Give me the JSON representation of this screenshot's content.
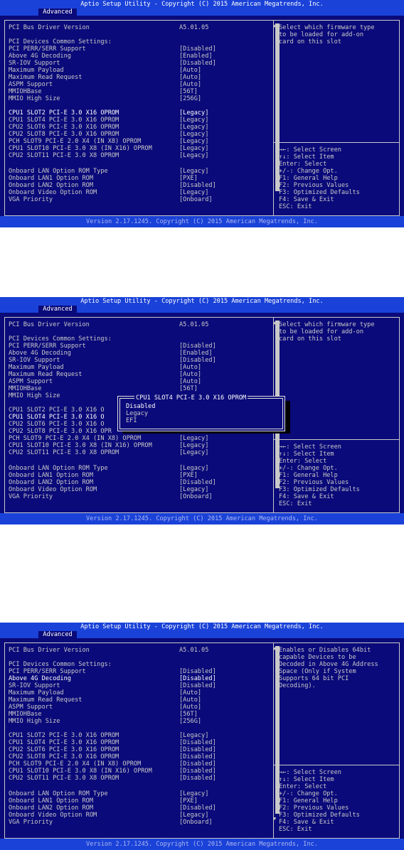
{
  "header_title": "Aptio Setup Utility - Copyright (C) 2015 American Megatrends, Inc.",
  "tab_label": "Advanced",
  "footer_text": "Version 2.17.1245. Copyright (C) 2015 American Megatrends, Inc.",
  "colors": {
    "background": "#0a0a7a",
    "header": "#1a42d8",
    "text": "#c9c9c9",
    "highlight": "#ffffff"
  },
  "screens": [
    {
      "rows": [
        {
          "label": "PCI Bus Driver Version",
          "value": "A5.01.05"
        },
        {
          "label": "PCI Devices Common Settings:",
          "value": ""
        },
        {
          "label": "PCI PERR/SERR Support",
          "value": "[Disabled]"
        },
        {
          "label": "Above 4G Decoding",
          "value": "[Enabled]"
        },
        {
          "label": "SR-IOV Support",
          "value": "[Disabled]"
        },
        {
          "label": "Maximum Payload",
          "value": "[Auto]"
        },
        {
          "label": "Maximum Read Request",
          "value": "[Auto]"
        },
        {
          "label": "ASPM Support",
          "value": "[Auto]"
        },
        {
          "label": "MMIOHBase",
          "value": "[56T]"
        },
        {
          "label": "MMIO High Size",
          "value": "[256G]"
        },
        {
          "label": "CPU1 SLOT2 PCI-E 3.0 X16 OPROM",
          "value": "[Legacy]"
        },
        {
          "label": "CPU1 SLOT4 PCI-E 3.0 X16 OPROM",
          "value": "[Legacy]"
        },
        {
          "label": "CPU2 SLOT6 PCI-E 3.0 X16 OPROM",
          "value": "[Legacy]"
        },
        {
          "label": "CPU2 SLOT8 PCI-E 3.0 X16 OPROM",
          "value": "[Legacy]"
        },
        {
          "label": "PCH SLOT9 PCI-E 2.0 X4 (IN X8) OPROM",
          "value": "[Legacy]"
        },
        {
          "label": "CPU1 SLOT10 PCI-E 3.0 X8 (IN X16) OPROM",
          "value": "[Legacy]"
        },
        {
          "label": "CPU2 SLOT11 PCI-E 3.0 X8 OPROM",
          "value": "[Legacy]"
        },
        {
          "label": "Onboard LAN Option ROM Type",
          "value": "[Legacy]"
        },
        {
          "label": "Onboard LAN1 Option ROM",
          "value": "[PXE]"
        },
        {
          "label": "Onboard LAN2 Option ROM",
          "value": "[Disabled]"
        },
        {
          "label": "Onboard Video Option ROM",
          "value": "[Legacy]"
        },
        {
          "label": "VGA Priority",
          "value": "[Onboard]"
        }
      ],
      "help_lines": [
        "Select which firmware type",
        "to be loaded for add-on",
        "card on this slot"
      ]
    },
    {
      "rows": [
        {
          "label": "PCI Bus Driver Version",
          "value": "A5.01.05"
        },
        {
          "label": "PCI Devices Common Settings:",
          "value": ""
        },
        {
          "label": "PCI PERR/SERR Support",
          "value": "[Disabled]"
        },
        {
          "label": "Above 4G Decoding",
          "value": "[Enabled]"
        },
        {
          "label": "SR-IOV Support",
          "value": "[Disabled]"
        },
        {
          "label": "Maximum Payload",
          "value": "[Auto]"
        },
        {
          "label": "Maximum Read Request",
          "value": "[Auto]"
        },
        {
          "label": "ASPM Support",
          "value": "[Auto]"
        },
        {
          "label": "MMIOHBase",
          "value": "[56T]"
        },
        {
          "label": "MMIO High Size",
          "value": ""
        },
        {
          "label": "CPU1 SLOT2 PCI-E 3.0 X16 O",
          "value": ""
        },
        {
          "label": "CPU1 SLOT4 PCI-E 3.0 X16 O",
          "value": ""
        },
        {
          "label": "CPU2 SLOT6 PCI-E 3.0 X16 O",
          "value": ""
        },
        {
          "label": "CPU2 SLOT8 PCI-E 3.0 X16 OPR",
          "value": ""
        },
        {
          "label": "PCH SLOT9 PCI-E 2.0 X4 (IN X8) OPROM",
          "value": "[Legacy]"
        },
        {
          "label": "CPU1 SLOT10 PCI-E 3.0 X8 (IN X16) OPROM",
          "value": "[Legacy]"
        },
        {
          "label": "CPU2 SLOT11 PCI-E 3.0 X8 OPROM",
          "value": "[Legacy]"
        },
        {
          "label": "Onboard LAN Option ROM Type",
          "value": "[Legacy]"
        },
        {
          "label": "Onboard LAN1 Option ROM",
          "value": "[PXE]"
        },
        {
          "label": "Onboard LAN2 Option ROM",
          "value": "[Disabled]"
        },
        {
          "label": "Onboard Video Option ROM",
          "value": "[Legacy]"
        },
        {
          "label": "VGA Priority",
          "value": "[Onboard]"
        }
      ],
      "help_lines": [
        "Select which firmware type",
        "to be loaded for add-on",
        "card on this slot"
      ],
      "popup": {
        "title": "CPU1 SLOT4 PCI-E 3.0 X16 OPROM",
        "options": [
          "Disabled",
          "Legacy",
          "EFI"
        ],
        "selected": "Disabled"
      }
    },
    {
      "rows": [
        {
          "label": "PCI Bus Driver Version",
          "value": "A5.01.05"
        },
        {
          "label": "PCI Devices Common Settings:",
          "value": ""
        },
        {
          "label": "PCI PERR/SERR Support",
          "value": "[Disabled]"
        },
        {
          "label": "Above 4G Decoding",
          "value": "[Disabled]"
        },
        {
          "label": "SR-IOV Support",
          "value": "[Disabled]"
        },
        {
          "label": "Maximum Payload",
          "value": "[Auto]"
        },
        {
          "label": "Maximum Read Request",
          "value": "[Auto]"
        },
        {
          "label": "ASPM Support",
          "value": "[Auto]"
        },
        {
          "label": "MMIOHBase",
          "value": "[56T]"
        },
        {
          "label": "MMIO High Size",
          "value": "[256G]"
        },
        {
          "label": "CPU1 SLOT2 PCI-E 3.0 X16 OPROM",
          "value": "[Legacy]"
        },
        {
          "label": "CPU1 SLOT4 PCI-E 3.0 X16 OPROM",
          "value": "[Disabled]"
        },
        {
          "label": "CPU2 SLOT6 PCI-E 3.0 X16 OPROM",
          "value": "[Disabled]"
        },
        {
          "label": "CPU2 SLOT8 PCI-E 3.0 X16 OPROM",
          "value": "[Disabled]"
        },
        {
          "label": "PCH SLOT9 PCI-E 2.0 X4 (IN X8) OPROM",
          "value": "[Disabled]"
        },
        {
          "label": "CPU1 SLOT10 PCI-E 3.0 X8 (IN X16) OPROM",
          "value": "[Disabled]"
        },
        {
          "label": "CPU2 SLOT11 PCI-E 3.0 X8 OPROM",
          "value": "[Disabled]"
        },
        {
          "label": "Onboard LAN Option ROM Type",
          "value": "[Legacy]"
        },
        {
          "label": "Onboard LAN1 Option ROM",
          "value": "[PXE]"
        },
        {
          "label": "Onboard LAN2 Option ROM",
          "value": "[Disabled]"
        },
        {
          "label": "Onboard Video Option ROM",
          "value": "[Legacy]"
        },
        {
          "label": "VGA Priority",
          "value": "[Onboard]"
        }
      ],
      "help_lines": [
        "Enables or Disables 64bit",
        "capable Devices to be",
        "Decoded in Above 4G Address",
        "Space (Only if System",
        "Supports 64 bit PCI",
        "Decoding)."
      ]
    }
  ],
  "key_help": [
    "→←: Select Screen",
    "↑↓: Select Item",
    "Enter: Select",
    "+/-: Change Opt.",
    "F1: General Help",
    "F2: Previous Values",
    "F3: Optimized Defaults",
    "F4: Save & Exit",
    "ESC: Exit"
  ]
}
